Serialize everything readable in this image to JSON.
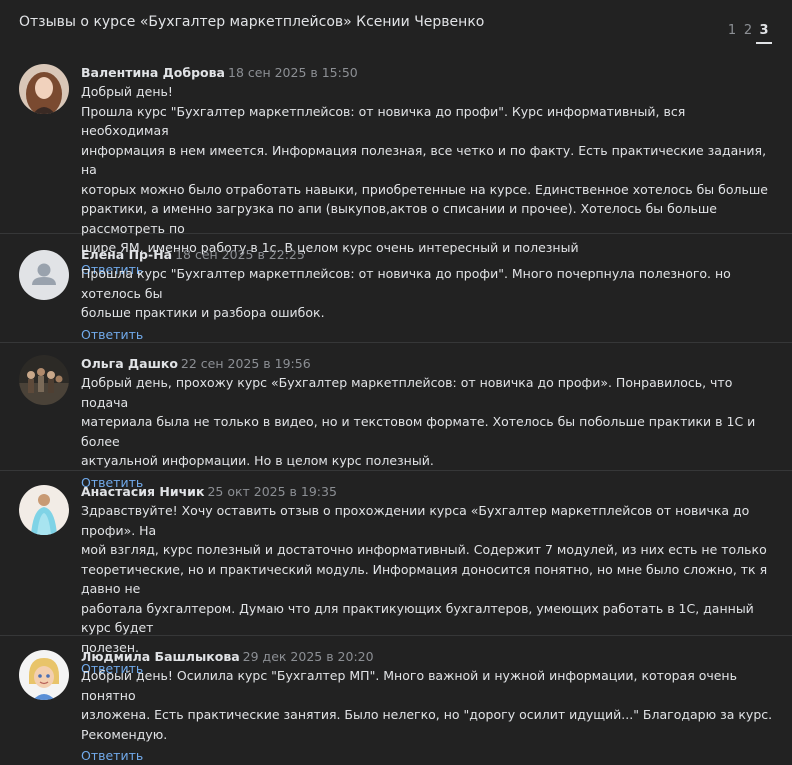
{
  "header": {
    "title": "Отзывы о курсе «Бухгалтер маркетплейсов» Ксении Червенко",
    "pages": [
      "1",
      "2",
      "3"
    ],
    "current_page": "3"
  },
  "reply_label": "Ответить",
  "comments": [
    {
      "author": "Валентина Доброва",
      "date": "18 сен 2025 в 15:50",
      "text": "Добрый день!\nПрошла курс \"Бухгалтер маркетплейсов: от новичка до профи\". Курс информативный, вся необходимая\nинформация в нем имеется. Информация полезная, все четко и по факту. Есть практические задания, на\nкоторых можно было отработать навыки, приобретенные на курсе. Единственное хотелось бы больше\npрактики, а именно загрузка по апи (выкупов,актов о списании и прочее). Хотелось бы больше рассмотреть по\nшире ЯМ, именно работу в 1с. В целом курс очень интересный и полезный",
      "reply": "Ответить"
    },
    {
      "author": "Елена Пр-На",
      "date": "18 сен 2025 в 22:25",
      "text": "Прошла курс \"Бухгалтер маркетплейсов: от новичка до профи\". Много почерпнула полезного. но хотелось бы\nбольше практики и разбора ошибок.",
      "reply": "Ответить"
    },
    {
      "author": "Ольга Дашко",
      "date": "22 сен 2025 в 19:56",
      "text": "Добрый день, прохожу курс «Бухгалтер маркетплейсов: от новичка до профи». Понравилось, что подача\nматериала была не только в видео, но и текстовом формате. Хотелось бы побольше практики в 1С и более\nактуальной информации. Но в целом курс полезный.",
      "reply": "Ответить"
    },
    {
      "author": "Анастасия Ничик",
      "date": "25 окт 2025 в 19:35",
      "text": "Здравствуйте! Хочу оставить отзыв о прохождении курса «Бухгалтер маркетплейсов от новичка до профи». На\nмой взгляд, курс полезный и достаточно информативный. Содержит 7 модулей, из них есть не только\nтеоретические, но и практический модуль. Информация доносится понятно, но мне было сложно, тк я давно не\nработала бухгалтером. Думаю что для практикующих бухгалтеров, умеющих работать в 1С, данный курс будет\nполезен.",
      "reply": "Ответить"
    },
    {
      "author": "Людмила Башлыкова",
      "date": "29 дек 2025 в 20:20",
      "text": "Добрый день! Осилила курс \"Бухгалтер МП\". Много важной и нужной информации, которая очень понятно\nизложена. Есть практические занятия. Было нелегко, но \"дорогу осилит идущий...\" Благодарю за курс.\nРекомендую.",
      "reply": "Ответить"
    }
  ],
  "colors": {
    "background": "#222222",
    "text": "#e1e3e6",
    "muted": "#8c8f94",
    "link": "#71aaeb",
    "divider": "#363738"
  }
}
